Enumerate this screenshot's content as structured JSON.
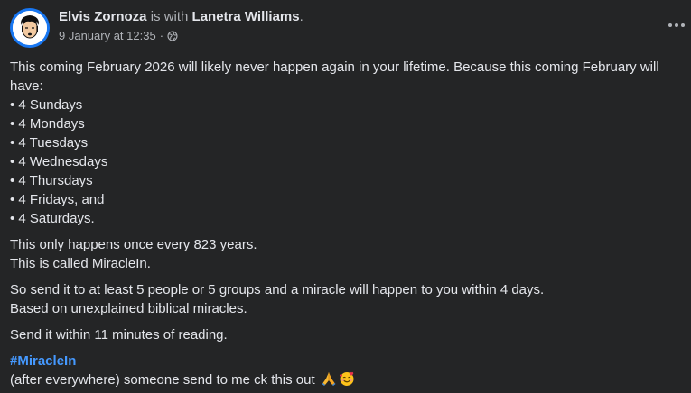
{
  "post": {
    "author": "Elvis Zornoza",
    "with_text": " is with ",
    "tagged_person": "Lanetra Williams",
    "end_period": ".",
    "timestamp": "9 January at 12:35",
    "separator": " · ",
    "privacy_icon": "globe-icon",
    "more_icon": "more-options-icon",
    "body": {
      "intro": "This coming February 2026 will likely never happen again in your lifetime. Because this coming February will have:",
      "bullets": [
        "• 4 Sundays",
        "• 4 Mondays",
        "• 4 Tuesdays",
        "• 4 Wednesdays",
        "• 4 Thursdays",
        "• 4 Fridays, and",
        "• 4 Saturdays."
      ],
      "para2_line1": "This only happens once every 823 years.",
      "para2_line2": "This is called MiracleIn.",
      "para3_line1": "So send it to at least 5 people or 5 groups and a miracle will happen to you within 4 days.",
      "para3_line2": "Based on unexplained biblical miracles.",
      "para4": "Send it within 11 minutes of reading.",
      "hashtag": "#MiracleIn",
      "final_line": "(after everywhere) someone send to me ck this out ",
      "emoji_1": "folded-hands-emoji",
      "emoji_2": "smiling-face-with-hearts-emoji"
    }
  },
  "colors": {
    "background": "#242526",
    "primary_text": "#e4e6eb",
    "secondary_text": "#b0b3b8",
    "hashtag": "#4599ff",
    "avatar_ring": "#1877f2"
  }
}
